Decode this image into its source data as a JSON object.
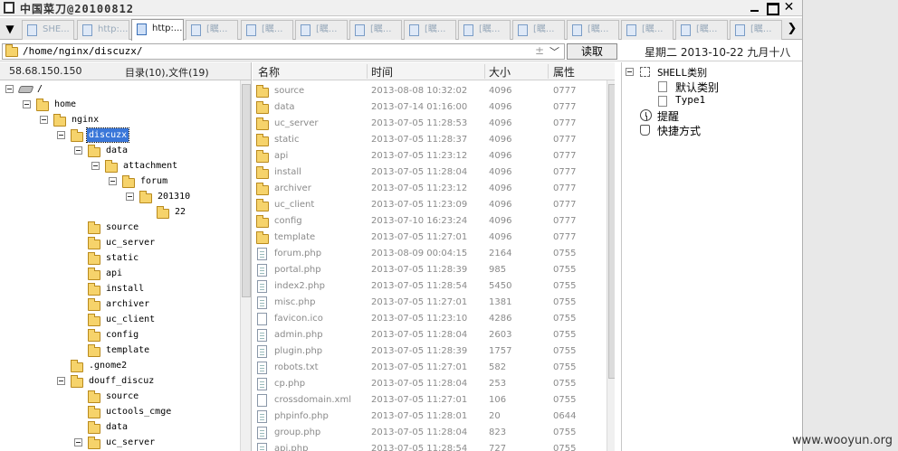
{
  "window": {
    "title": "中国菜刀@20100812"
  },
  "tabs": [
    {
      "label": "SHE..."
    },
    {
      "label": "http:..."
    },
    {
      "label": "http:..."
    },
    {
      "label": "[瞩..."
    },
    {
      "label": "[瞩..."
    },
    {
      "label": "[瞩..."
    },
    {
      "label": "[瞩..."
    },
    {
      "label": "[瞩..."
    },
    {
      "label": "[瞩..."
    },
    {
      "label": "[瞩..."
    },
    {
      "label": "[瞩..."
    },
    {
      "label": "[瞩..."
    },
    {
      "label": "[瞩..."
    },
    {
      "label": "[瞩..."
    }
  ],
  "active_tab_index": 2,
  "address": {
    "path": "/home/nginx/discuzx/",
    "spin_glyph": "±",
    "read_label": "读取",
    "date": "星期二 2013-10-22 九月十八"
  },
  "left": {
    "ip": "58.68.150.150",
    "counts": "目录(10),文件(19)",
    "tree": [
      {
        "label": "/",
        "depth": 0,
        "icon": "drive",
        "toggle": true
      },
      {
        "label": "home",
        "depth": 1,
        "icon": "folder",
        "toggle": true
      },
      {
        "label": "nginx",
        "depth": 2,
        "icon": "folder",
        "toggle": true
      },
      {
        "label": "discuzx",
        "depth": 3,
        "icon": "folder-open",
        "toggle": true,
        "selected": true
      },
      {
        "label": "data",
        "depth": 4,
        "icon": "folder",
        "toggle": true
      },
      {
        "label": "attachment",
        "depth": 5,
        "icon": "folder",
        "toggle": true
      },
      {
        "label": "forum",
        "depth": 6,
        "icon": "folder",
        "toggle": true
      },
      {
        "label": "201310",
        "depth": 7,
        "icon": "folder",
        "toggle": true
      },
      {
        "label": "22",
        "depth": 8,
        "icon": "folder",
        "toggle": false
      },
      {
        "label": "source",
        "depth": 4,
        "icon": "folder",
        "toggle": false
      },
      {
        "label": "uc_server",
        "depth": 4,
        "icon": "folder",
        "toggle": false
      },
      {
        "label": "static",
        "depth": 4,
        "icon": "folder",
        "toggle": false
      },
      {
        "label": "api",
        "depth": 4,
        "icon": "folder",
        "toggle": false
      },
      {
        "label": "install",
        "depth": 4,
        "icon": "folder",
        "toggle": false
      },
      {
        "label": "archiver",
        "depth": 4,
        "icon": "folder",
        "toggle": false
      },
      {
        "label": "uc_client",
        "depth": 4,
        "icon": "folder",
        "toggle": false
      },
      {
        "label": "config",
        "depth": 4,
        "icon": "folder",
        "toggle": false
      },
      {
        "label": "template",
        "depth": 4,
        "icon": "folder",
        "toggle": false
      },
      {
        "label": ".gnome2",
        "depth": 3,
        "icon": "folder",
        "toggle": false
      },
      {
        "label": "douff_discuz",
        "depth": 3,
        "icon": "folder",
        "toggle": true
      },
      {
        "label": "source",
        "depth": 4,
        "icon": "folder",
        "toggle": false
      },
      {
        "label": "uctools_cmge",
        "depth": 4,
        "icon": "folder",
        "toggle": false
      },
      {
        "label": "data",
        "depth": 4,
        "icon": "folder",
        "toggle": false
      },
      {
        "label": "uc_server",
        "depth": 4,
        "icon": "folder",
        "toggle": true
      }
    ]
  },
  "files": {
    "columns": {
      "name": "名称",
      "time": "时间",
      "size": "大小",
      "perm": "属性"
    },
    "rows": [
      {
        "name": "source",
        "time": "2013-08-08 10:32:02",
        "size": "4096",
        "perm": "0777",
        "type": "folder"
      },
      {
        "name": "data",
        "time": "2013-07-14 01:16:00",
        "size": "4096",
        "perm": "0777",
        "type": "folder"
      },
      {
        "name": "uc_server",
        "time": "2013-07-05 11:28:53",
        "size": "4096",
        "perm": "0777",
        "type": "folder"
      },
      {
        "name": "static",
        "time": "2013-07-05 11:28:37",
        "size": "4096",
        "perm": "0777",
        "type": "folder"
      },
      {
        "name": "api",
        "time": "2013-07-05 11:23:12",
        "size": "4096",
        "perm": "0777",
        "type": "folder"
      },
      {
        "name": "install",
        "time": "2013-07-05 11:28:04",
        "size": "4096",
        "perm": "0777",
        "type": "folder"
      },
      {
        "name": "archiver",
        "time": "2013-07-05 11:23:12",
        "size": "4096",
        "perm": "0777",
        "type": "folder"
      },
      {
        "name": "uc_client",
        "time": "2013-07-05 11:23:09",
        "size": "4096",
        "perm": "0777",
        "type": "folder"
      },
      {
        "name": "config",
        "time": "2013-07-10 16:23:24",
        "size": "4096",
        "perm": "0777",
        "type": "folder"
      },
      {
        "name": "template",
        "time": "2013-07-05 11:27:01",
        "size": "4096",
        "perm": "0777",
        "type": "folder"
      },
      {
        "name": "forum.php",
        "time": "2013-08-09 00:04:15",
        "size": "2164",
        "perm": "0755",
        "type": "file"
      },
      {
        "name": "portal.php",
        "time": "2013-07-05 11:28:39",
        "size": "985",
        "perm": "0755",
        "type": "file"
      },
      {
        "name": "index2.php",
        "time": "2013-07-05 11:28:54",
        "size": "5450",
        "perm": "0755",
        "type": "file"
      },
      {
        "name": "misc.php",
        "time": "2013-07-05 11:27:01",
        "size": "1381",
        "perm": "0755",
        "type": "file"
      },
      {
        "name": "favicon.ico",
        "time": "2013-07-05 11:23:10",
        "size": "4286",
        "perm": "0755",
        "type": "blank"
      },
      {
        "name": "admin.php",
        "time": "2013-07-05 11:28:04",
        "size": "2603",
        "perm": "0755",
        "type": "file"
      },
      {
        "name": "plugin.php",
        "time": "2013-07-05 11:28:39",
        "size": "1757",
        "perm": "0755",
        "type": "file"
      },
      {
        "name": "robots.txt",
        "time": "2013-07-05 11:27:01",
        "size": "582",
        "perm": "0755",
        "type": "file"
      },
      {
        "name": "cp.php",
        "time": "2013-07-05 11:28:04",
        "size": "253",
        "perm": "0755",
        "type": "file"
      },
      {
        "name": "crossdomain.xml",
        "time": "2013-07-05 11:27:01",
        "size": "106",
        "perm": "0755",
        "type": "blank"
      },
      {
        "name": "phpinfo.php",
        "time": "2013-07-05 11:28:01",
        "size": "20",
        "perm": "0644",
        "type": "file"
      },
      {
        "name": "group.php",
        "time": "2013-07-05 11:28:04",
        "size": "823",
        "perm": "0755",
        "type": "file"
      },
      {
        "name": "api.php",
        "time": "2013-07-05 11:28:54",
        "size": "727",
        "perm": "0755",
        "type": "file"
      }
    ]
  },
  "right": {
    "items": [
      {
        "label": "SHELL类别",
        "depth": 0,
        "icon": "square",
        "toggle": true,
        "mono": true
      },
      {
        "label": "默认类别",
        "depth": 1,
        "icon": "page",
        "toggle": false,
        "mono": false
      },
      {
        "label": "Type1",
        "depth": 1,
        "icon": "page",
        "toggle": false,
        "mono": true
      },
      {
        "label": "提醒",
        "depth": 0,
        "icon": "clock",
        "toggle": false,
        "mono": false
      },
      {
        "label": "快捷方式",
        "depth": 0,
        "icon": "hand",
        "toggle": false,
        "mono": false
      }
    ]
  },
  "watermark": "www.wooyun.org"
}
